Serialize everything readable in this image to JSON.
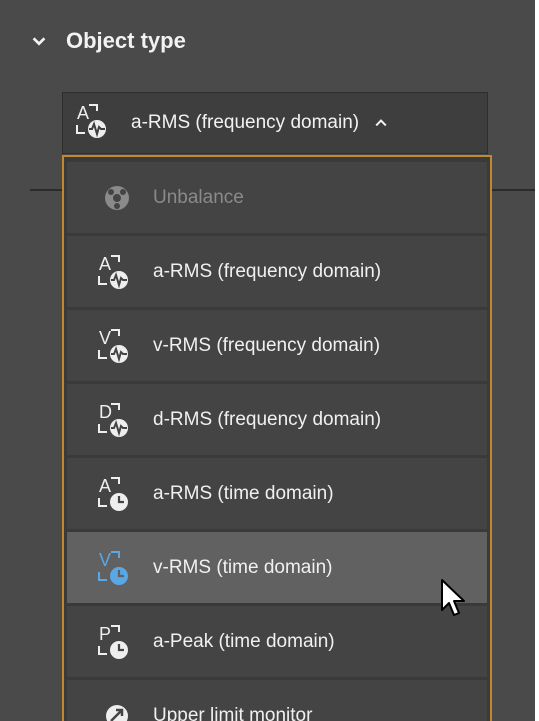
{
  "header": {
    "title": "Object type"
  },
  "selector": {
    "selected_label": "a-RMS (frequency domain)"
  },
  "options": [
    {
      "label": "Unbalance",
      "icon": "unbalance-icon",
      "state": "disabled"
    },
    {
      "label": "a-RMS (frequency domain)",
      "icon": "a-rms-frequency-icon",
      "state": "normal"
    },
    {
      "label": "v-RMS (frequency domain)",
      "icon": "v-rms-frequency-icon",
      "state": "normal"
    },
    {
      "label": "d-RMS (frequency domain)",
      "icon": "d-rms-frequency-icon",
      "state": "normal"
    },
    {
      "label": "a-RMS (time domain)",
      "icon": "a-rms-time-icon",
      "state": "normal"
    },
    {
      "label": "v-RMS (time domain)",
      "icon": "v-rms-time-icon",
      "state": "hover"
    },
    {
      "label": "a-Peak (time domain)",
      "icon": "a-peak-time-icon",
      "state": "normal"
    },
    {
      "label": "Upper limit monitor",
      "icon": "upper-limit-monitor-icon",
      "state": "normal"
    }
  ],
  "colors": {
    "panel_bg": "#4a4a4a",
    "option_bg": "#444444",
    "option_hover_bg": "#616161",
    "focus_border": "#c0892f",
    "hover_icon_blue": "#5aa7e6"
  }
}
